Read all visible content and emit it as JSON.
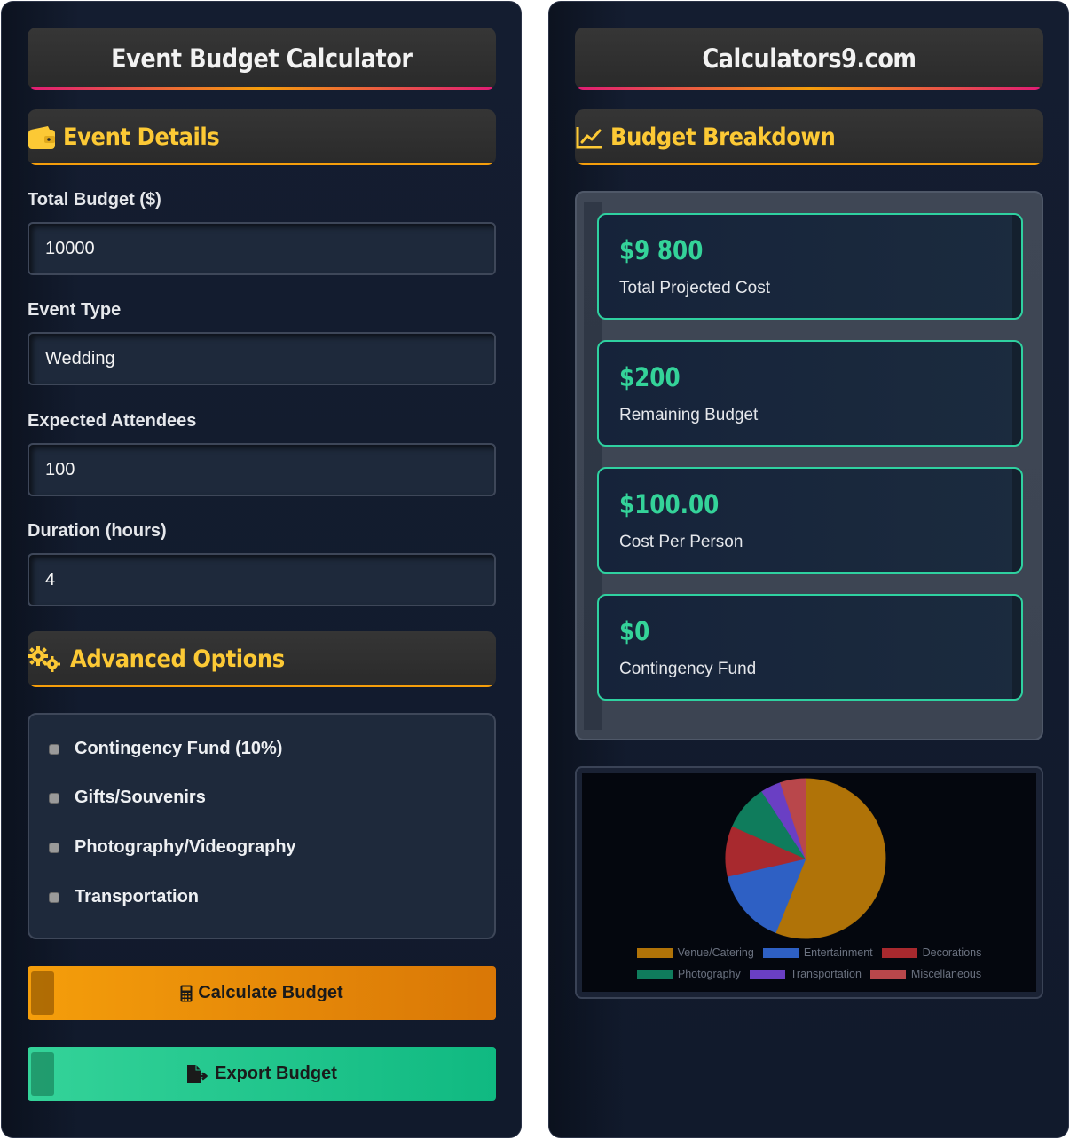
{
  "left": {
    "title": "Event Budget Calculator",
    "event_details": {
      "heading": "Event Details",
      "icon": "wallet-icon",
      "fields": [
        {
          "label": "Total Budget ($)",
          "value": "10000"
        },
        {
          "label": "Event Type",
          "value": "Wedding"
        },
        {
          "label": "Expected Attendees",
          "value": "100"
        },
        {
          "label": "Duration (hours)",
          "value": "4"
        }
      ]
    },
    "advanced": {
      "heading": "Advanced Options",
      "icon": "gears-icon",
      "options": [
        {
          "label": "Contingency Fund (10%)",
          "checked": false
        },
        {
          "label": "Gifts/Souvenirs",
          "checked": false
        },
        {
          "label": "Photography/Videography",
          "checked": false
        },
        {
          "label": "Transportation",
          "checked": false
        }
      ]
    },
    "buttons": {
      "calculate": "Calculate Budget",
      "export": "Export Budget"
    }
  },
  "right": {
    "title": "Calculators9.com",
    "breakdown": {
      "heading": "Budget Breakdown",
      "icon": "line-chart-icon",
      "stats": [
        {
          "value": "$9 800",
          "label": "Total Projected Cost"
        },
        {
          "value": "$200",
          "label": "Remaining Budget"
        },
        {
          "value": "$100.00",
          "label": "Cost Per Person"
        },
        {
          "value": "$0",
          "label": "Contingency Fund"
        }
      ]
    }
  },
  "colors": {
    "accent_yellow": "#fcc935",
    "accent_green": "#34d399",
    "calc_button": "#f59e0b",
    "export_button": "#10b981",
    "title_underline": "#e11d74"
  },
  "chart_data": {
    "type": "pie",
    "title": "",
    "categories": [
      "Venue/Catering",
      "Entertainment",
      "Decorations",
      "Photography",
      "Transportation",
      "Miscellaneous"
    ],
    "values": [
      55,
      15,
      10,
      9,
      4,
      5
    ],
    "colors": [
      "#b07308",
      "#2e60c4",
      "#a8292e",
      "#0f7c5c",
      "#6a3fc4",
      "#b9474b"
    ],
    "legend": "bottom"
  }
}
